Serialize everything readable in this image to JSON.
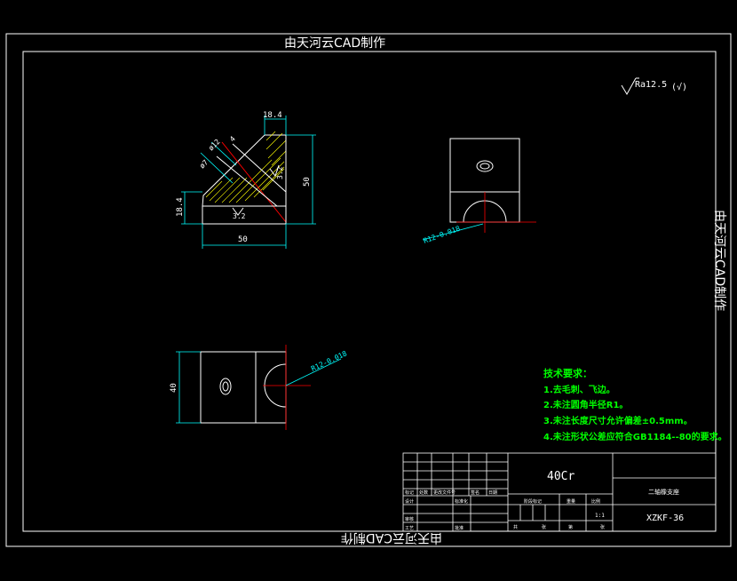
{
  "watermark": {
    "top": "由天河云CAD制作",
    "right": "由天河云CAD制作",
    "bottom": "由天河云CAD制作"
  },
  "roughness": {
    "symbol": "Ra12.5",
    "suffix": "(√)"
  },
  "dimensions": {
    "top_width": "18.4",
    "height_right": "50",
    "left_height": "18.4",
    "bottom_width": "50",
    "diag_a": "ø12",
    "diag_b": "ø7",
    "diag_c": "4",
    "rough_a": "3.2",
    "rough_b": "3.2",
    "side_radius": "R12-0.018",
    "bottom_radius": "R12-0.018",
    "bottom_height": "40"
  },
  "notes": {
    "title": "技术要求：",
    "items": [
      "1.去毛刺、飞边。",
      "2.未注圆角半径R1。",
      "3.未注长度尺寸允许偏差±0.5mm。",
      "4.未注形状公差应符合GB1184--80的要求。"
    ]
  },
  "title_block": {
    "material": "40Cr",
    "part_name": "二轴橡支座",
    "drawing_no": "XZKF-36",
    "scale": "1:1",
    "labels": [
      "标记",
      "处数",
      "更改文件号",
      "签名",
      "日期",
      "设计",
      "标准化",
      "审核",
      "工艺",
      "批准",
      "阶段标记",
      "重量",
      "比例",
      "共",
      "张",
      "第",
      "张"
    ]
  },
  "colors": {
    "frame": "#ffffff",
    "outline": "#ffffff",
    "dimension": "#00ffff",
    "center": "#ff0000",
    "hatch": "#ffff00",
    "note": "#00ff00",
    "roughness": "#ffffff"
  }
}
